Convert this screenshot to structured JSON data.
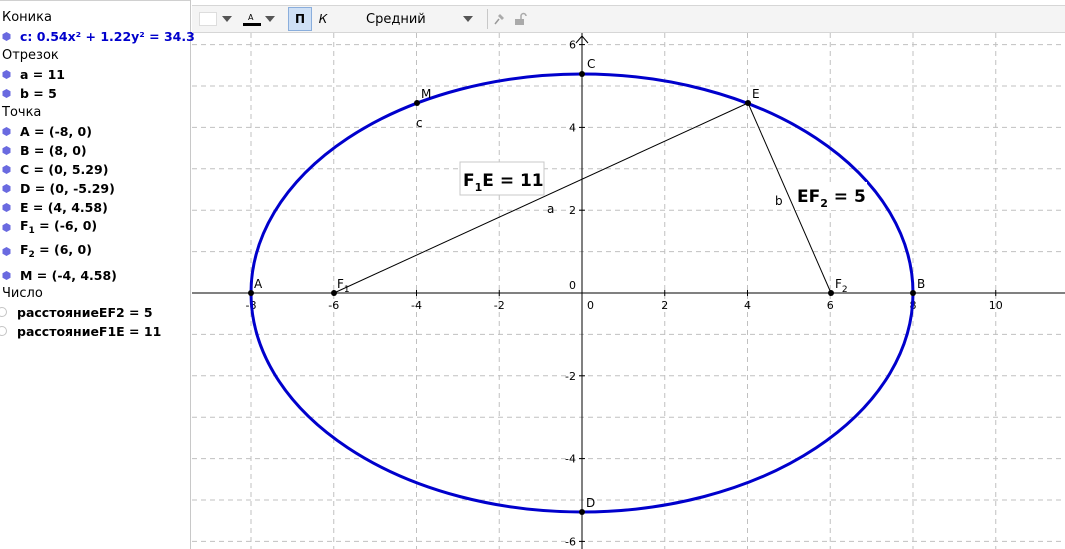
{
  "algebra": {
    "categories": {
      "conic": "Коника",
      "segment": "Отрезок",
      "point": "Точка",
      "number": "Число"
    },
    "conic_c": "c: 0.54x² + 1.22y² = 34.3",
    "segments": [
      "a = 11",
      "b = 5"
    ],
    "points": [
      "A = (-8, 0)",
      "B = (8, 0)",
      "C = (0, 5.29)",
      "D = (0, -5.29)",
      "E = (4, 4.58)"
    ],
    "f1_def": {
      "main": "F",
      "sub": "1",
      "rest": " = (-6, 0)"
    },
    "f2_def": {
      "main": "F",
      "sub": "2",
      "rest": " = (6, 0)"
    },
    "point_m": "M = (-4, 4.58)",
    "numbers": [
      "расстояниеEF2 = 5",
      "расстояниеF1E = 11"
    ]
  },
  "toolbar": {
    "bold": "П",
    "italic": "К",
    "text_size": "Средний"
  },
  "graph": {
    "labels": {
      "A": "A",
      "B": "B",
      "C": "C",
      "D": "D",
      "E": "E",
      "M": "M",
      "c": "c",
      "a": "a",
      "b": "b",
      "F1": "F",
      "F1sub": "1",
      "F2": "F",
      "F2sub": "2"
    },
    "text_f1e": {
      "pre": "F",
      "sub": "1",
      "post": "E = 11"
    },
    "text_ef2": {
      "pre": "EF",
      "sub": "2",
      "post": " = 5"
    },
    "x_ticks": [
      "-8",
      "-6",
      "-4",
      "-2",
      "0",
      "2",
      "4",
      "6",
      "8",
      "10"
    ],
    "y_ticks": [
      "6",
      "4",
      "2",
      "0",
      "-2",
      "-4",
      "-6"
    ]
  },
  "colors": {
    "conic": "#0000cc",
    "point_icon": "#6a6ae0",
    "grid": "#c0c0c0"
  }
}
